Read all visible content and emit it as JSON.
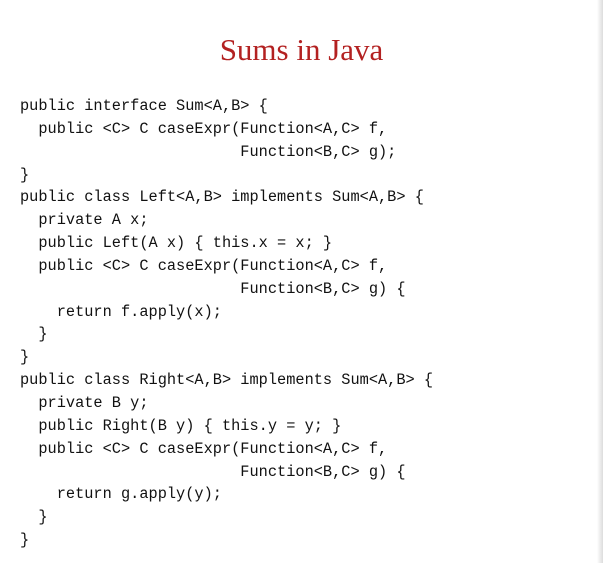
{
  "slide": {
    "title": "Sums in Java",
    "code_lines": [
      "public interface Sum<A,B> {",
      "  public <C> C caseExpr(Function<A,C> f,",
      "                        Function<B,C> g);",
      "}",
      "public class Left<A,B> implements Sum<A,B> {",
      "  private A x;",
      "  public Left(A x) { this.x = x; }",
      "  public <C> C caseExpr(Function<A,C> f,",
      "                        Function<B,C> g) {",
      "    return f.apply(x);",
      "  }",
      "}",
      "public class Right<A,B> implements Sum<A,B> {",
      "  private B y;",
      "  public Right(B y) { this.y = y; }",
      "  public <C> C caseExpr(Function<A,C> f,",
      "                        Function<B,C> g) {",
      "    return g.apply(y);",
      "  }",
      "}"
    ]
  }
}
